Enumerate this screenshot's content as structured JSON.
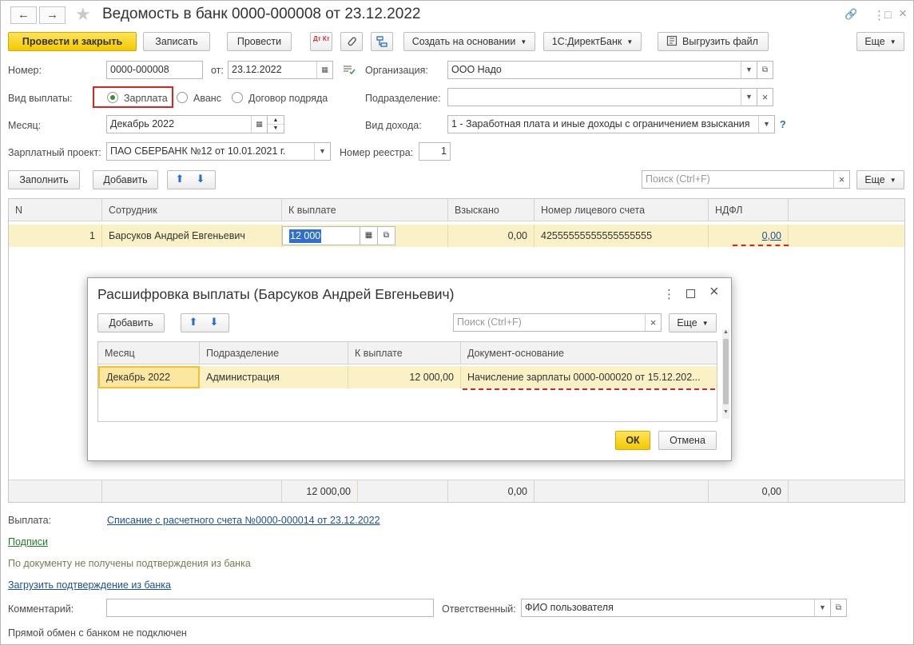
{
  "window": {
    "title": "Ведомость в банк 0000-000008 от 23.12.2022",
    "back_icon": "←",
    "forward_icon": "→",
    "star_icon": "★",
    "link_icon": "🔗",
    "more_icon": "⋮",
    "maximize_icon": "□",
    "close_icon": "×"
  },
  "toolbar": {
    "post_close": "Провести и закрыть",
    "save": "Записать",
    "post": "Провести",
    "dtkt": "Дт Кт",
    "create_based": "Создать на основании",
    "directbank": "1С:ДиректБанк",
    "export_file": "Выгрузить файл",
    "more": "Еще"
  },
  "form": {
    "number_label": "Номер:",
    "number_value": "0000-000008",
    "date_label": "от:",
    "date_value": "23.12.2022",
    "org_label": "Организация:",
    "org_value": "ООО Надо",
    "payment_type_label": "Вид выплаты:",
    "payment_types": [
      "Зарплата",
      "Аванс",
      "Договор подряда"
    ],
    "selected_payment_type": "Зарплата",
    "division_label": "Подразделение:",
    "division_value": "",
    "month_label": "Месяц:",
    "month_value": "Декабрь 2022",
    "income_type_label": "Вид дохода:",
    "income_type_value": "1 - Заработная плата и иные доходы с ограничением взыскания",
    "help_mark": "?",
    "salary_project_label": "Зарплатный проект:",
    "salary_project_value": "ПАО СБЕРБАНК №12 от 10.01.2021 г.",
    "registry_number_label": "Номер реестра:",
    "registry_number_value": "1"
  },
  "table_toolbar": {
    "fill": "Заполнить",
    "add": "Добавить",
    "search_placeholder": "Поиск (Ctrl+F)",
    "more": "Еще"
  },
  "table": {
    "columns": [
      "N",
      "Сотрудник",
      "К выплате",
      "Взыскано",
      "Номер лицевого счета",
      "НДФЛ"
    ],
    "rows": [
      {
        "n": "1",
        "employee": "Барсуков Андрей Евгеньевич",
        "to_pay": "12 000",
        "withheld": "0,00",
        "account": "42555555555555555555",
        "ndfl": "0,00"
      }
    ],
    "totals": {
      "to_pay": "12 000,00",
      "withheld": "0,00",
      "ndfl": "0,00"
    }
  },
  "modal": {
    "title": "Расшифровка выплаты (Барсуков Андрей Евгеньевич)",
    "add": "Добавить",
    "search_placeholder": "Поиск (Ctrl+F)",
    "more": "Еще",
    "columns": [
      "Месяц",
      "Подразделение",
      "К выплате",
      "Документ-основание"
    ],
    "rows": [
      {
        "month": "Декабрь 2022",
        "division": "Администрация",
        "to_pay": "12 000,00",
        "basis": "Начисление зарплаты 0000-000020 от 15.12.202..."
      }
    ],
    "ok": "ОК",
    "cancel": "Отмена"
  },
  "bottom": {
    "payment_label": "Выплата:",
    "payment_link": "Списание с расчетного счета №0000-000014 от 23.12.2022",
    "signatures_link": "Подписи",
    "bank_status": "По документу не получены подтверждения из банка",
    "load_confirmation_link": "Загрузить подтверждение из банка",
    "comment_label": "Комментарий:",
    "comment_value": "",
    "responsible_label": "Ответственный:",
    "responsible_value": "ФИО пользователя",
    "direct_exchange_status": "Прямой обмен с банком не подключен"
  },
  "colors": {
    "primary_button": "#f4c900",
    "selected_row": "#fbf1c6",
    "link": "#1c4f9c",
    "highlight_red": "#dd2222"
  }
}
